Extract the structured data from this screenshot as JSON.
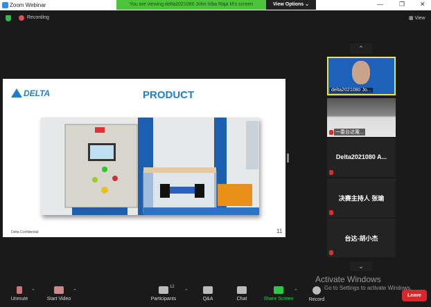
{
  "window": {
    "title": "Zoom Webinar",
    "minimize": "—",
    "restore": "❐",
    "close": "✕"
  },
  "banner": {
    "text": "You are viewing delta2021080 John Inba Raja M's screen",
    "view_options": "View Options ⌄"
  },
  "topbar": {
    "recording": "Recording",
    "view": "▦ View"
  },
  "slide": {
    "logo": "DELTA",
    "title": "PRODUCT",
    "footer": "Delta Confidential",
    "page": "11"
  },
  "gallery": {
    "up": "⌃",
    "down": "⌄",
    "tiles": [
      {
        "name": "delta2021080 Jo..."
      },
      {
        "name": "一委台达電..."
      },
      {
        "name": "Delta2021080 A..."
      },
      {
        "name": "决赛主持人 张瑜"
      },
      {
        "name": "台达-胡小杰"
      }
    ]
  },
  "toolbar": {
    "unmute": "Unmute",
    "start_video": "Start Video",
    "participants": "Participants",
    "participants_count": "12",
    "qa": "Q&A",
    "chat": "Chat",
    "share_screen": "Share Screen",
    "record": "Record",
    "leave": "Leave",
    "caret": "⌃"
  },
  "watermark": {
    "title": "Activate Windows",
    "subtitle": "Go to Settings to activate Windows."
  }
}
